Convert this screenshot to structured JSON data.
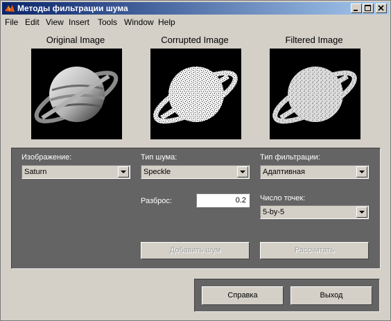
{
  "window": {
    "title": "Методы фильтрации шума"
  },
  "menu": [
    "File",
    "Edit",
    "View",
    "Insert",
    "Tools",
    "Window",
    "Help"
  ],
  "images": {
    "original": "Original Image",
    "corrupted": "Corrupted Image",
    "filtered": "Filtered Image"
  },
  "controls": {
    "image_label": "Изображение:",
    "image_value": "Saturn",
    "noise_type_label": "Тип шума:",
    "noise_type_value": "Speckle",
    "filter_type_label": "Тип фильтрации:",
    "filter_type_value": "Адаптивная",
    "spread_label": "Разброс:",
    "spread_value": "0.2",
    "points_label": "Число точек:",
    "points_value": "5-by-5",
    "add_noise_button": "Добавить шум",
    "compute_button": "Рассчитать"
  },
  "bottom": {
    "help_button": "Справка",
    "exit_button": "Выход"
  },
  "colors": {
    "panel": "#646464",
    "window_bg": "#d4d0c8",
    "titlebar_start": "#0a246a",
    "titlebar_end": "#a6caf0"
  }
}
